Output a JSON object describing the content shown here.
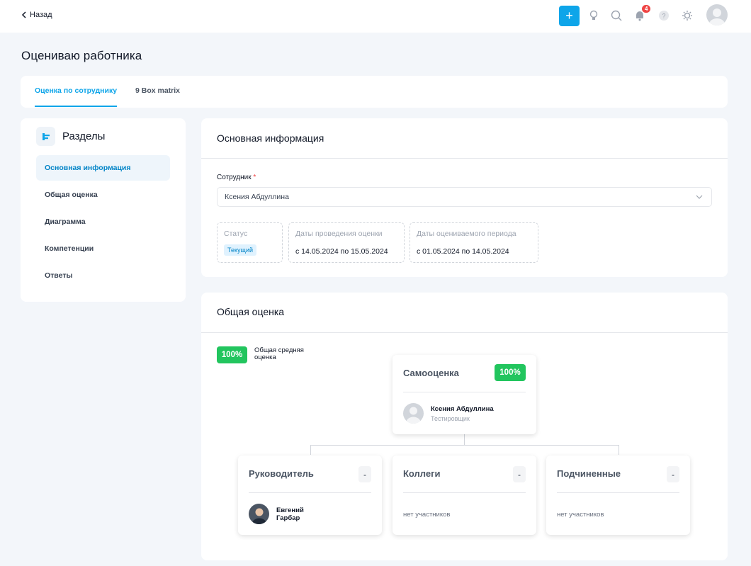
{
  "topbar": {
    "back_label": "Назад",
    "notifications_count": "4",
    "icons": [
      "plus-icon",
      "lightbulb-icon",
      "search-icon",
      "bell-icon",
      "help-icon",
      "sun-icon",
      "avatar"
    ],
    "accent": "#0ea5e9"
  },
  "page": {
    "title": "Оцениваю работника"
  },
  "tabs": [
    {
      "label": "Оценка по сотруднику",
      "active": true
    },
    {
      "label": "9 Box matrix",
      "active": false
    }
  ],
  "sections": {
    "title": "Разделы",
    "items": [
      {
        "label": "Основная информация",
        "active": true
      },
      {
        "label": "Общая оценка",
        "active": false
      },
      {
        "label": "Диаграмма",
        "active": false
      },
      {
        "label": "Компетенции",
        "active": false
      },
      {
        "label": "Ответы",
        "active": false
      }
    ]
  },
  "main_info": {
    "title": "Основная информация",
    "employee_label": "Сотрудник",
    "required_mark": "*",
    "employee_value": "Ксения Абдуллина",
    "status": {
      "label": "Статус",
      "value": "Текущий"
    },
    "assessment_dates": {
      "label": "Даты проведения оценки",
      "value": "с 14.05.2024 по 15.05.2024"
    },
    "period_dates": {
      "label": "Даты оцениваемого периода",
      "value": "с 01.05.2024 по 14.05.2024"
    }
  },
  "overall": {
    "title": "Общая оценка",
    "avg_percent": "100%",
    "avg_label": "Общая средняя оценка",
    "self": {
      "title": "Самооценка",
      "percent": "100%",
      "person_name": "Ксения Абдуллина",
      "person_role": "Тестировщик"
    },
    "manager": {
      "title": "Руководитель",
      "score": "-",
      "person_name": "Евгений Гарбар"
    },
    "colleagues": {
      "title": "Коллеги",
      "score": "-",
      "empty_text": "нет участников"
    },
    "subordinates": {
      "title": "Подчиненные",
      "score": "-",
      "empty_text": "нет участников"
    },
    "success_color": "#22c55e"
  }
}
